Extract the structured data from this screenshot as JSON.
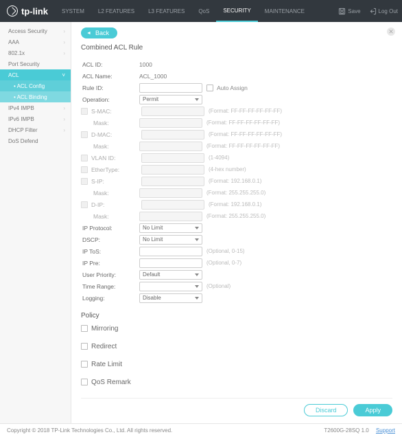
{
  "brand": "tp-link",
  "header": {
    "tabs": [
      "SYSTEM",
      "L2 FEATURES",
      "L3 FEATURES",
      "QoS",
      "SECURITY",
      "MAINTENANCE"
    ],
    "active": 4,
    "save": "Save",
    "logout": "Log Out"
  },
  "sidebar": {
    "items": [
      {
        "label": "Access Security",
        "exp": true
      },
      {
        "label": "AAA",
        "exp": true
      },
      {
        "label": "802.1x",
        "exp": true
      },
      {
        "label": "Port Security"
      },
      {
        "label": "ACL",
        "active": true,
        "exp": true,
        "sub": [
          {
            "label": "ACL Config",
            "active": true
          },
          {
            "label": "ACL Binding"
          }
        ]
      },
      {
        "label": "IPv4 IMPB",
        "exp": true
      },
      {
        "label": "IPv6 IMPB",
        "exp": true
      },
      {
        "label": "DHCP Filter",
        "exp": true
      },
      {
        "label": "DoS Defend"
      }
    ]
  },
  "page": {
    "back": "Back",
    "title": "Combined ACL Rule",
    "acl_id_label": "ACL ID:",
    "acl_id": "1000",
    "acl_name_label": "ACL Name:",
    "acl_name": "ACL_1000",
    "rule_id_label": "Rule ID:",
    "auto": "Auto Assign",
    "operation_label": "Operation:",
    "operation": "Permit",
    "fields": [
      {
        "chk": true,
        "label": "S-MAC:",
        "hint": "(Format: FF-FF-FF-FF-FF-FF)"
      },
      {
        "sub": true,
        "label": "Mask:",
        "hint": "(Format: FF-FF-FF-FF-FF-FF)"
      },
      {
        "chk": true,
        "label": "D-MAC:",
        "hint": "(Format: FF-FF-FF-FF-FF-FF)"
      },
      {
        "sub": true,
        "label": "Mask:",
        "hint": "(Format: FF-FF-FF-FF-FF-FF)"
      },
      {
        "chk": true,
        "label": "VLAN ID:",
        "hint": "(1-4094)"
      },
      {
        "chk": true,
        "label": "EtherType:",
        "hint": "(4-hex number)"
      },
      {
        "chk": true,
        "label": "S-IP:",
        "hint": "(Format: 192.168.0.1)"
      },
      {
        "sub": true,
        "label": "Mask:",
        "hint": "(Format: 255.255.255.0)"
      },
      {
        "chk": true,
        "label": "D-IP:",
        "hint": "(Format: 192.168.0.1)"
      },
      {
        "sub": true,
        "label": "Mask:",
        "hint": "(Format: 255.255.255.0)"
      }
    ],
    "ip_proto_label": "IP Protocol:",
    "ip_proto": "No Limit",
    "dscp_label": "DSCP:",
    "dscp": "No Limit",
    "ip_tos_label": "IP ToS:",
    "ip_tos_hint": "(Optional, 0-15)",
    "ip_pre_label": "IP Pre:",
    "ip_pre_hint": "(Optional, 0-7)",
    "up_label": "User Priority:",
    "up": "Default",
    "tr_label": "Time Range:",
    "tr_hint": "(Optional)",
    "log_label": "Logging:",
    "log": "Disable",
    "policy_label": "Policy",
    "policies": [
      "Mirroring",
      "Redirect",
      "Rate Limit",
      "QoS Remark"
    ],
    "discard": "Discard",
    "apply": "Apply"
  },
  "footer": {
    "copyright": "Copyright © 2018    TP-Link Technologies Co., Ltd. All rights reserved.",
    "model": "T2600G-28SQ 1.0",
    "support": "Support"
  }
}
